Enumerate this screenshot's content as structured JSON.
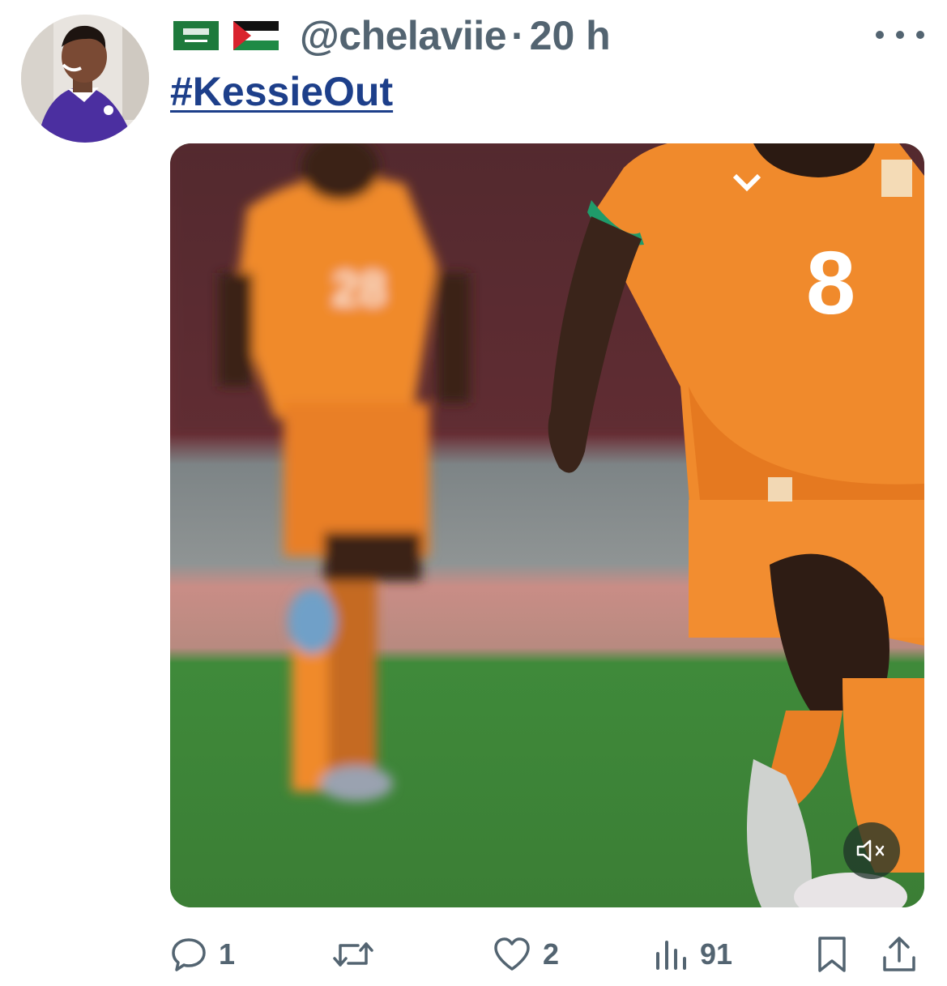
{
  "post": {
    "flags": [
      "saudi-arabia-flag",
      "palestine-flag"
    ],
    "handle": "@chelaviie",
    "separator": "·",
    "time": "20 h",
    "text": "#KessieOut",
    "media": {
      "type": "video",
      "muted": true,
      "jersey_number": "8"
    }
  },
  "actions": {
    "replies": "1",
    "reposts": "",
    "likes": "2",
    "views": "91"
  },
  "colors": {
    "handle_gray": "#536471",
    "hashtag_blue": "#1d3f8a",
    "jersey_orange": "#f08a2c",
    "pitch_green": "#3f8a3a"
  },
  "icons": [
    "more-icon",
    "mute-icon",
    "reply-icon",
    "repost-icon",
    "like-icon",
    "views-icon",
    "bookmark-icon",
    "share-icon"
  ]
}
